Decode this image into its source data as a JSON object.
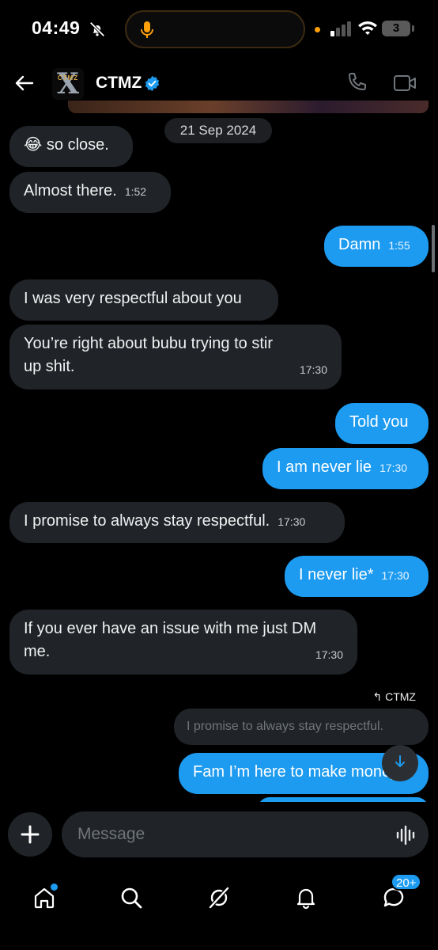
{
  "status_bar": {
    "time": "04:49",
    "battery": "3"
  },
  "header": {
    "contact_name": "CTMZ",
    "avatar_text": "CTMZ"
  },
  "chat": {
    "date": "21 Sep 2024",
    "messages": [
      {
        "dir": "in",
        "text": "😂 so close.",
        "time": ""
      },
      {
        "dir": "in",
        "text": "Almost there.",
        "time": "1:52"
      },
      {
        "dir": "out",
        "text": "Damn",
        "time": "1:55"
      },
      {
        "dir": "in",
        "text": "I was very respectful about you",
        "time": ""
      },
      {
        "dir": "in",
        "text": "You’re right about bubu trying to stir up shit.",
        "time": "17:30"
      },
      {
        "dir": "out",
        "text": "Told you",
        "time": ""
      },
      {
        "dir": "out",
        "text": "I am never lie",
        "time": "17:30"
      },
      {
        "dir": "in",
        "text": "I promise to always stay respectful.",
        "time": "17:30"
      },
      {
        "dir": "out",
        "text": "I never lie*",
        "time": "17:30"
      },
      {
        "dir": "in",
        "text": "If you ever have an issue with me just DM me.",
        "time": "17:30"
      },
      {
        "dir": "out",
        "text": "Fam I’m here to make money",
        "time": ""
      }
    ],
    "reply_to_label": "CTMZ",
    "reply_quote": "I promise to always stay respectful."
  },
  "composer": {
    "placeholder": "Message"
  },
  "nav": {
    "messages_badge": "20+"
  },
  "colors": {
    "accent": "#1d9bf0",
    "incoming_bubble": "#202327",
    "background": "#000000"
  }
}
